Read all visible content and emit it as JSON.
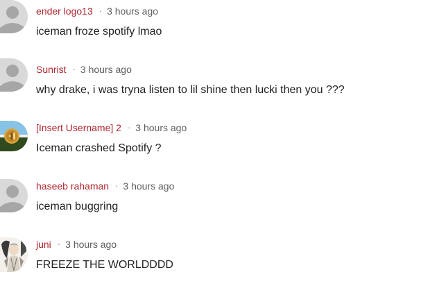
{
  "comments": [
    {
      "author": "ender logo13",
      "separator": "·",
      "time": "3 hours ago",
      "text": "iceman froze spotify lmao",
      "avatar": "default-user-icon"
    },
    {
      "author": "Sunrist",
      "separator": "·",
      "time": "3 hours ago",
      "text": "why drake, i was tryna listen to lil shine then lucki then you ???",
      "avatar": "default-user-icon"
    },
    {
      "author": "[Insert Username] 2",
      "separator": "·",
      "time": "3 hours ago",
      "text": "Iceman crashed Spotify ?",
      "avatar": "emblem-avatar"
    },
    {
      "author": "haseeb rahaman",
      "separator": "·",
      "time": "3 hours ago",
      "text": "iceman buggring",
      "avatar": "default-user-icon"
    },
    {
      "author": "juni",
      "separator": "·",
      "time": "3 hours ago",
      "text": "FREEZE THE WORLDDDD",
      "avatar": "illustrated-avatar"
    }
  ],
  "colors": {
    "author": "#b0242e",
    "timestamp": "#5e5e5e",
    "text": "#222222",
    "avatar_placeholder_bg": "#d9d9d9",
    "avatar_placeholder_fg": "#a6a6a6"
  }
}
